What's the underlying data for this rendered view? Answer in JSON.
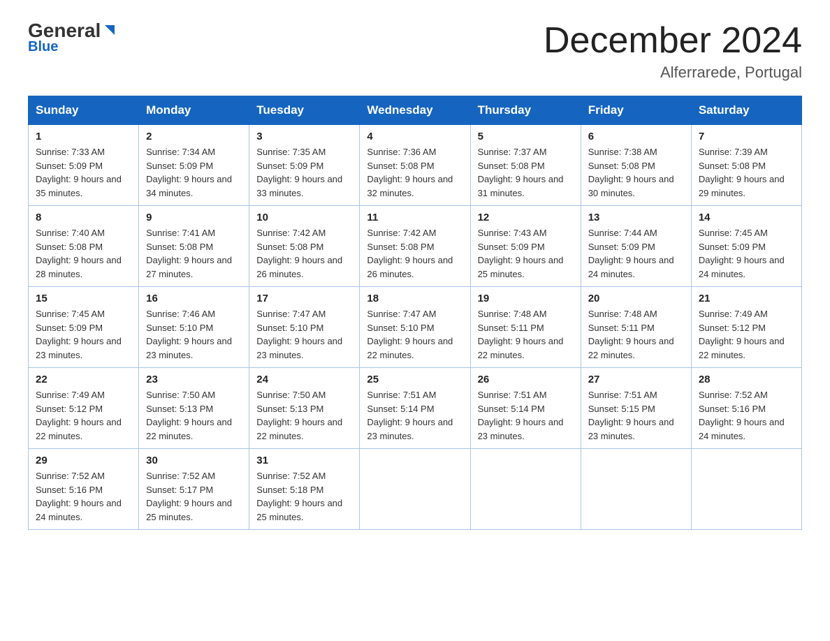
{
  "header": {
    "logo_general": "General",
    "logo_blue": "Blue",
    "month_title": "December 2024",
    "location": "Alferrarede, Portugal"
  },
  "days_of_week": [
    "Sunday",
    "Monday",
    "Tuesday",
    "Wednesday",
    "Thursday",
    "Friday",
    "Saturday"
  ],
  "weeks": [
    [
      {
        "day": "1",
        "sunrise": "7:33 AM",
        "sunset": "5:09 PM",
        "daylight": "9 hours and 35 minutes."
      },
      {
        "day": "2",
        "sunrise": "7:34 AM",
        "sunset": "5:09 PM",
        "daylight": "9 hours and 34 minutes."
      },
      {
        "day": "3",
        "sunrise": "7:35 AM",
        "sunset": "5:09 PM",
        "daylight": "9 hours and 33 minutes."
      },
      {
        "day": "4",
        "sunrise": "7:36 AM",
        "sunset": "5:08 PM",
        "daylight": "9 hours and 32 minutes."
      },
      {
        "day": "5",
        "sunrise": "7:37 AM",
        "sunset": "5:08 PM",
        "daylight": "9 hours and 31 minutes."
      },
      {
        "day": "6",
        "sunrise": "7:38 AM",
        "sunset": "5:08 PM",
        "daylight": "9 hours and 30 minutes."
      },
      {
        "day": "7",
        "sunrise": "7:39 AM",
        "sunset": "5:08 PM",
        "daylight": "9 hours and 29 minutes."
      }
    ],
    [
      {
        "day": "8",
        "sunrise": "7:40 AM",
        "sunset": "5:08 PM",
        "daylight": "9 hours and 28 minutes."
      },
      {
        "day": "9",
        "sunrise": "7:41 AM",
        "sunset": "5:08 PM",
        "daylight": "9 hours and 27 minutes."
      },
      {
        "day": "10",
        "sunrise": "7:42 AM",
        "sunset": "5:08 PM",
        "daylight": "9 hours and 26 minutes."
      },
      {
        "day": "11",
        "sunrise": "7:42 AM",
        "sunset": "5:08 PM",
        "daylight": "9 hours and 26 minutes."
      },
      {
        "day": "12",
        "sunrise": "7:43 AM",
        "sunset": "5:09 PM",
        "daylight": "9 hours and 25 minutes."
      },
      {
        "day": "13",
        "sunrise": "7:44 AM",
        "sunset": "5:09 PM",
        "daylight": "9 hours and 24 minutes."
      },
      {
        "day": "14",
        "sunrise": "7:45 AM",
        "sunset": "5:09 PM",
        "daylight": "9 hours and 24 minutes."
      }
    ],
    [
      {
        "day": "15",
        "sunrise": "7:45 AM",
        "sunset": "5:09 PM",
        "daylight": "9 hours and 23 minutes."
      },
      {
        "day": "16",
        "sunrise": "7:46 AM",
        "sunset": "5:10 PM",
        "daylight": "9 hours and 23 minutes."
      },
      {
        "day": "17",
        "sunrise": "7:47 AM",
        "sunset": "5:10 PM",
        "daylight": "9 hours and 23 minutes."
      },
      {
        "day": "18",
        "sunrise": "7:47 AM",
        "sunset": "5:10 PM",
        "daylight": "9 hours and 22 minutes."
      },
      {
        "day": "19",
        "sunrise": "7:48 AM",
        "sunset": "5:11 PM",
        "daylight": "9 hours and 22 minutes."
      },
      {
        "day": "20",
        "sunrise": "7:48 AM",
        "sunset": "5:11 PM",
        "daylight": "9 hours and 22 minutes."
      },
      {
        "day": "21",
        "sunrise": "7:49 AM",
        "sunset": "5:12 PM",
        "daylight": "9 hours and 22 minutes."
      }
    ],
    [
      {
        "day": "22",
        "sunrise": "7:49 AM",
        "sunset": "5:12 PM",
        "daylight": "9 hours and 22 minutes."
      },
      {
        "day": "23",
        "sunrise": "7:50 AM",
        "sunset": "5:13 PM",
        "daylight": "9 hours and 22 minutes."
      },
      {
        "day": "24",
        "sunrise": "7:50 AM",
        "sunset": "5:13 PM",
        "daylight": "9 hours and 22 minutes."
      },
      {
        "day": "25",
        "sunrise": "7:51 AM",
        "sunset": "5:14 PM",
        "daylight": "9 hours and 23 minutes."
      },
      {
        "day": "26",
        "sunrise": "7:51 AM",
        "sunset": "5:14 PM",
        "daylight": "9 hours and 23 minutes."
      },
      {
        "day": "27",
        "sunrise": "7:51 AM",
        "sunset": "5:15 PM",
        "daylight": "9 hours and 23 minutes."
      },
      {
        "day": "28",
        "sunrise": "7:52 AM",
        "sunset": "5:16 PM",
        "daylight": "9 hours and 24 minutes."
      }
    ],
    [
      {
        "day": "29",
        "sunrise": "7:52 AM",
        "sunset": "5:16 PM",
        "daylight": "9 hours and 24 minutes."
      },
      {
        "day": "30",
        "sunrise": "7:52 AM",
        "sunset": "5:17 PM",
        "daylight": "9 hours and 25 minutes."
      },
      {
        "day": "31",
        "sunrise": "7:52 AM",
        "sunset": "5:18 PM",
        "daylight": "9 hours and 25 minutes."
      },
      null,
      null,
      null,
      null
    ]
  ]
}
